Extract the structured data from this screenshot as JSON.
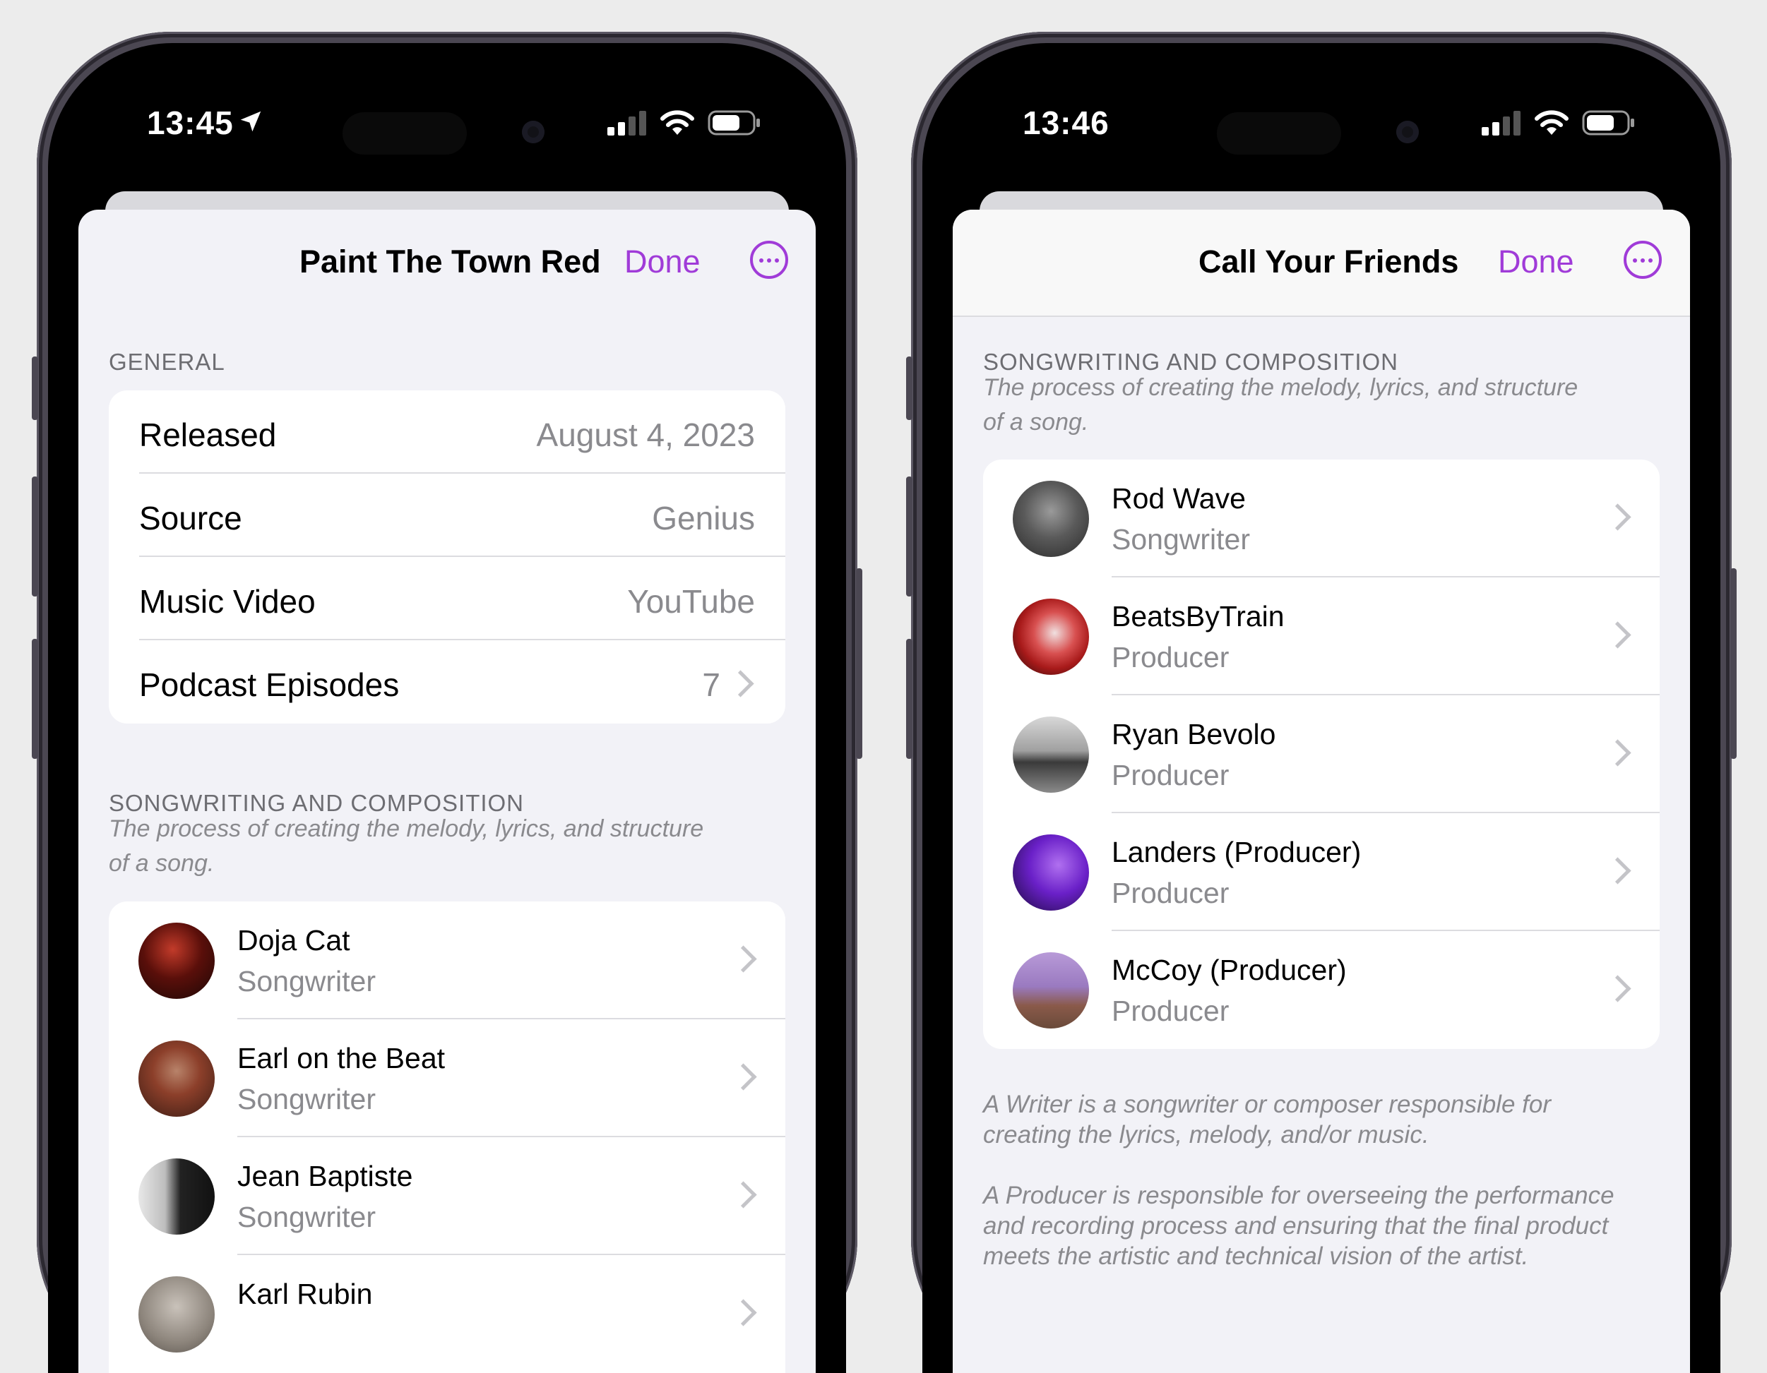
{
  "left_phone": {
    "status": {
      "time": "13:45"
    },
    "nav": {
      "title": "Paint The Town Red",
      "done_label": "Done"
    },
    "general": {
      "header": "GENERAL",
      "rows": [
        {
          "label": "Released",
          "value": "August 4, 2023"
        },
        {
          "label": "Source",
          "value": "Genius"
        },
        {
          "label": "Music Video",
          "value": "YouTube"
        },
        {
          "label": "Podcast Episodes",
          "value": "7"
        }
      ]
    },
    "songwriting": {
      "header": "SONGWRITING AND COMPOSITION",
      "description": "The process of creating the melody, lyrics, and structure of a song.",
      "people": [
        {
          "name": "Doja Cat",
          "role": "Songwriter"
        },
        {
          "name": "Earl on the Beat",
          "role": "Songwriter"
        },
        {
          "name": "Jean Baptiste",
          "role": "Songwriter"
        },
        {
          "name": "Karl Rubin",
          "role": ""
        }
      ]
    }
  },
  "right_phone": {
    "status": {
      "time": "13:46"
    },
    "nav": {
      "title": "Call Your Friends",
      "done_label": "Done"
    },
    "songwriting": {
      "header": "SONGWRITING AND COMPOSITION",
      "description": "The process of creating the melody, lyrics, and structure of a song.",
      "people": [
        {
          "name": "Rod Wave",
          "role": "Songwriter"
        },
        {
          "name": "BeatsByTrain",
          "role": "Producer"
        },
        {
          "name": "Ryan Bevolo",
          "role": "Producer"
        },
        {
          "name": "Landers (Producer)",
          "role": "Producer"
        },
        {
          "name": "McCoy (Producer)",
          "role": "Producer"
        }
      ]
    },
    "footer": {
      "writer_note": "A Writer is a songwriter or composer responsible for creating the lyrics, melody, and/or music.",
      "producer_note": "A Producer is responsible for overseeing the performance and recording process and ensuring that the final product meets the artistic and technical vision of the artist."
    }
  },
  "colors": {
    "accent": "#a03bd8",
    "background": "#f2f2f7",
    "secondary_text": "#8a8a8e"
  },
  "icons": [
    "location-arrow-icon",
    "cellular-signal-icon",
    "wifi-icon",
    "battery-icon",
    "more-ellipsis-icon",
    "chevron-right-icon"
  ]
}
